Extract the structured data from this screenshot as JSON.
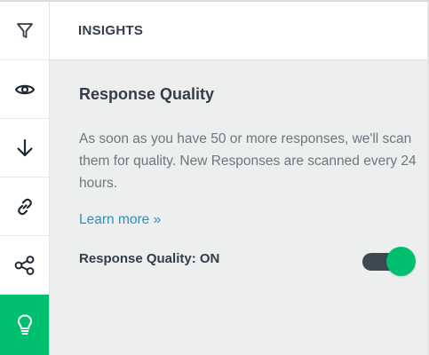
{
  "header": {
    "title": "INSIGHTS"
  },
  "sidebar": {
    "items": [
      {
        "icon": "filter-icon",
        "active": false
      },
      {
        "icon": "eye-icon",
        "active": false
      },
      {
        "icon": "arrow-down-icon",
        "active": false
      },
      {
        "icon": "link-icon",
        "active": false
      },
      {
        "icon": "share-icon",
        "active": false
      },
      {
        "icon": "lightbulb-icon",
        "active": true
      }
    ]
  },
  "panel": {
    "title": "Response Quality",
    "description": "As soon as you have 50 or more responses, we'll scan them for quality. New Responses are scanned every 24 hours.",
    "learn_more": "Learn more »",
    "toggle_label": "Response Quality: ON",
    "toggle_on": true
  },
  "colors": {
    "accent": "#00bf6f",
    "link": "#2e8fbd",
    "heading": "#333e48",
    "body_text": "#6b787f",
    "panel_bg": "#edeeee",
    "toggle_track": "#3d4850"
  }
}
